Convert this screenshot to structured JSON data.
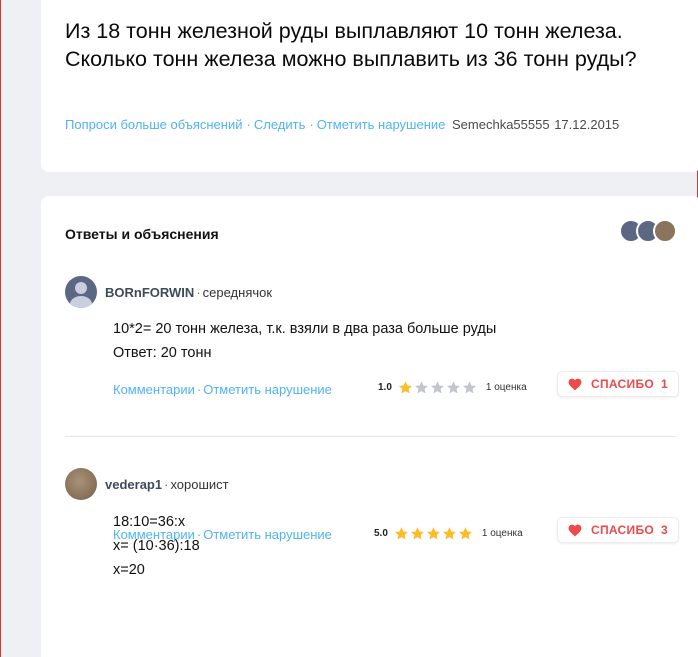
{
  "question": {
    "text": "Из 18 тонн железной руды выплавляют 10 тонн железа. Сколько тонн железа можно выплавить из 36 тонн руды?",
    "links": {
      "ask_more": "Попроси больше объяснений",
      "follow": "Следить",
      "report": "Отметить нарушение"
    },
    "author": "Semechka55555",
    "date": "17.12.2015"
  },
  "answers_section": {
    "title": "Ответы и объяснения"
  },
  "answers": [
    {
      "username": "BORnFORWIN",
      "rank": "середнячок",
      "body_lines": [
        "10*2= 20 тонн железа, т.к. взяли в два раза больше руды",
        "Ответ: 20 тонн"
      ],
      "comments_label": "Комментарии",
      "report_label": "Отметить нарушение",
      "rating_score": "1.0",
      "rating_value": 1,
      "rating_count": "1 оценка",
      "thanks_label": "СПАСИБО",
      "thanks_count": "1"
    },
    {
      "username": "vederap1",
      "rank": "хорошист",
      "body_lines": [
        "18:10=36:x",
        "x= (10·36):18",
        "x=20"
      ],
      "comments_label": "Комментарии",
      "report_label": "Отметить нарушение",
      "rating_score": "5.0",
      "rating_value": 5,
      "rating_count": "1 оценка",
      "thanks_label": "СПАСИБО",
      "thanks_count": "3"
    }
  ],
  "colors": {
    "link": "#4fb3f6",
    "star_filled": "#fbbe28",
    "star_empty": "#c3c7cd",
    "thanks": "#ef4a4a",
    "background": "#eef0f3"
  },
  "icons": {
    "heart": "heart-icon",
    "star": "star-icon",
    "avatar_default": "default-avatar-icon"
  }
}
